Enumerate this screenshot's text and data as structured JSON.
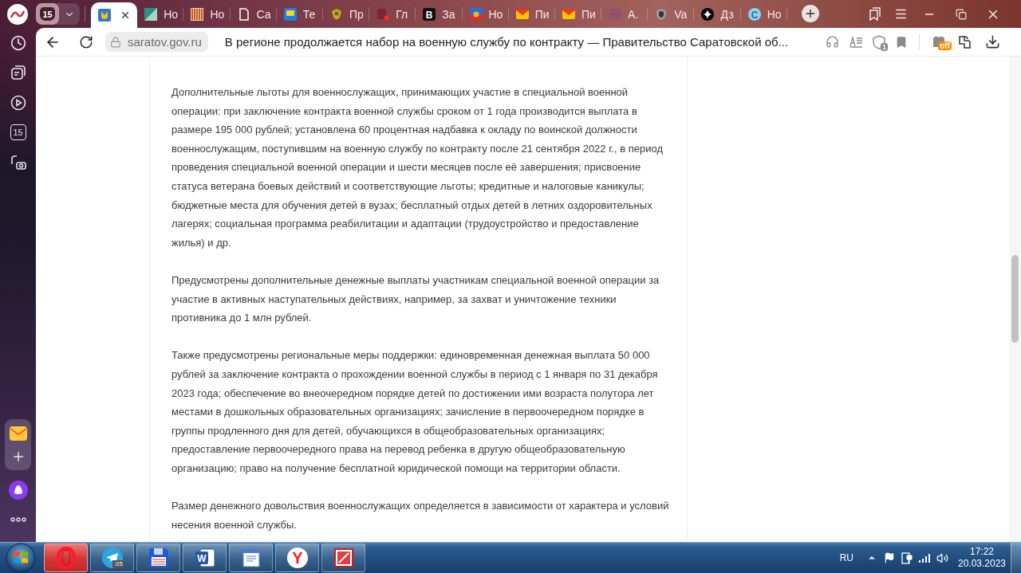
{
  "tab_strip": {
    "tab_counter": "15",
    "tabs": [
      {
        "kind": "emblem",
        "selected": true
      },
      {
        "kind": "diagonal",
        "title": "Но",
        "selected": false
      },
      {
        "kind": "bars",
        "title": "Но",
        "selected": false
      },
      {
        "kind": "document",
        "title": "Са",
        "selected": false
      },
      {
        "kind": "monitor",
        "title": "Те",
        "selected": false
      },
      {
        "kind": "crest",
        "title": "Пр",
        "selected": false
      },
      {
        "kind": "dot",
        "title": "Гл",
        "selected": false
      },
      {
        "kind": "letter",
        "icon_text": "B",
        "title": "За",
        "selected": false
      },
      {
        "kind": "picture",
        "title": "Но",
        "selected": false
      },
      {
        "kind": "mail",
        "title": "Пи",
        "selected": false
      },
      {
        "kind": "mail",
        "title": "Пи",
        "selected": false
      },
      {
        "kind": "stripes",
        "title": "A.",
        "selected": false
      },
      {
        "kind": "shield",
        "title": "Va",
        "selected": false
      },
      {
        "kind": "star",
        "title": "Дз",
        "selected": false
      },
      {
        "kind": "letter-circle",
        "icon_text": "C",
        "title": "Но",
        "selected": false
      }
    ]
  },
  "address_bar": {
    "url": "saratov.gov.ru",
    "page_title": "В регионе продолжается набор на военную службу по контракту — Правительство Саратовской об...",
    "protect_badge": "1",
    "extension_badge": "off"
  },
  "sidebar": {
    "top_items": [
      {
        "kind": "history"
      },
      {
        "kind": "collections"
      },
      {
        "kind": "video"
      },
      {
        "kind": "calendar",
        "label": "15"
      },
      {
        "kind": "screenshot"
      }
    ],
    "pinned_panel": [
      {
        "kind": "mail"
      },
      {
        "kind": "add"
      }
    ],
    "bottom_items": [
      {
        "kind": "assistant"
      },
      {
        "kind": "more"
      }
    ]
  },
  "article": {
    "paragraphs": [
      "Дополнительные льготы для военнослужащих, принимающих участие в специальной военной операции: при заключение контракта военной службы сроком от 1 года производится выплата в размере 195 000 рублей; установлена 60 процентная надбавка к окладу по воинской должности военнослужащим, поступившим на военную службу по контракту после 21 сентября 2022 г., в период проведения специальной военной операции и шести месяцев после её завершения; присвоение статуса ветерана боевых действий и соответствующие льготы; кредитные и налоговые каникулы; бюджетные места для обучения детей в вузах; бесплатный отдых детей в летних оздоровительных лагерях; социальная программа реабилитации и адаптации (трудоустройство и предоставление жилья) и др.",
      "Предусмотрены дополнительные денежные выплаты участникам специальной военной операции за участие в активных наступательных действиях, например, за захват и уничтожение техники противника до 1 млн рублей.",
      "Также предусмотрены региональные меры поддержки: единовременная денежная выплата 50 000 рублей за заключение контракта о прохождении военной службы в период с 1 января по 31 декабря 2023 года; обеспечение во внеочередном порядке детей по достижении ими возраста полутора лет местами в дошкольных образовательных организациях; зачисление в первоочередном порядке в группы продленного дня для детей, обучающихся в общеобразовательных организациях; предоставление первоочередного права на перевод ребенка в другую общеобразовательную организацию; право на получение бесплатной юридической помощи на территории области.",
      "Размер денежного довольствия военнослужащих определяется в зависимости от характера и условий несения военной службы."
    ]
  },
  "taskbar": {
    "apps": [
      {
        "kind": "opera",
        "attention": true
      },
      {
        "kind": "telegram",
        "badge": ".05",
        "attention": false
      },
      {
        "kind": "floppy",
        "attention": false
      },
      {
        "kind": "word",
        "icon_text": "W",
        "attention": false
      },
      {
        "kind": "document",
        "attention": false
      },
      {
        "kind": "yandex",
        "icon_text": "Y",
        "attention": false
      },
      {
        "kind": "picture",
        "attention": false
      }
    ],
    "tray": {
      "language": "RU",
      "time": "17:22",
      "date": "20.03.2023"
    }
  }
}
